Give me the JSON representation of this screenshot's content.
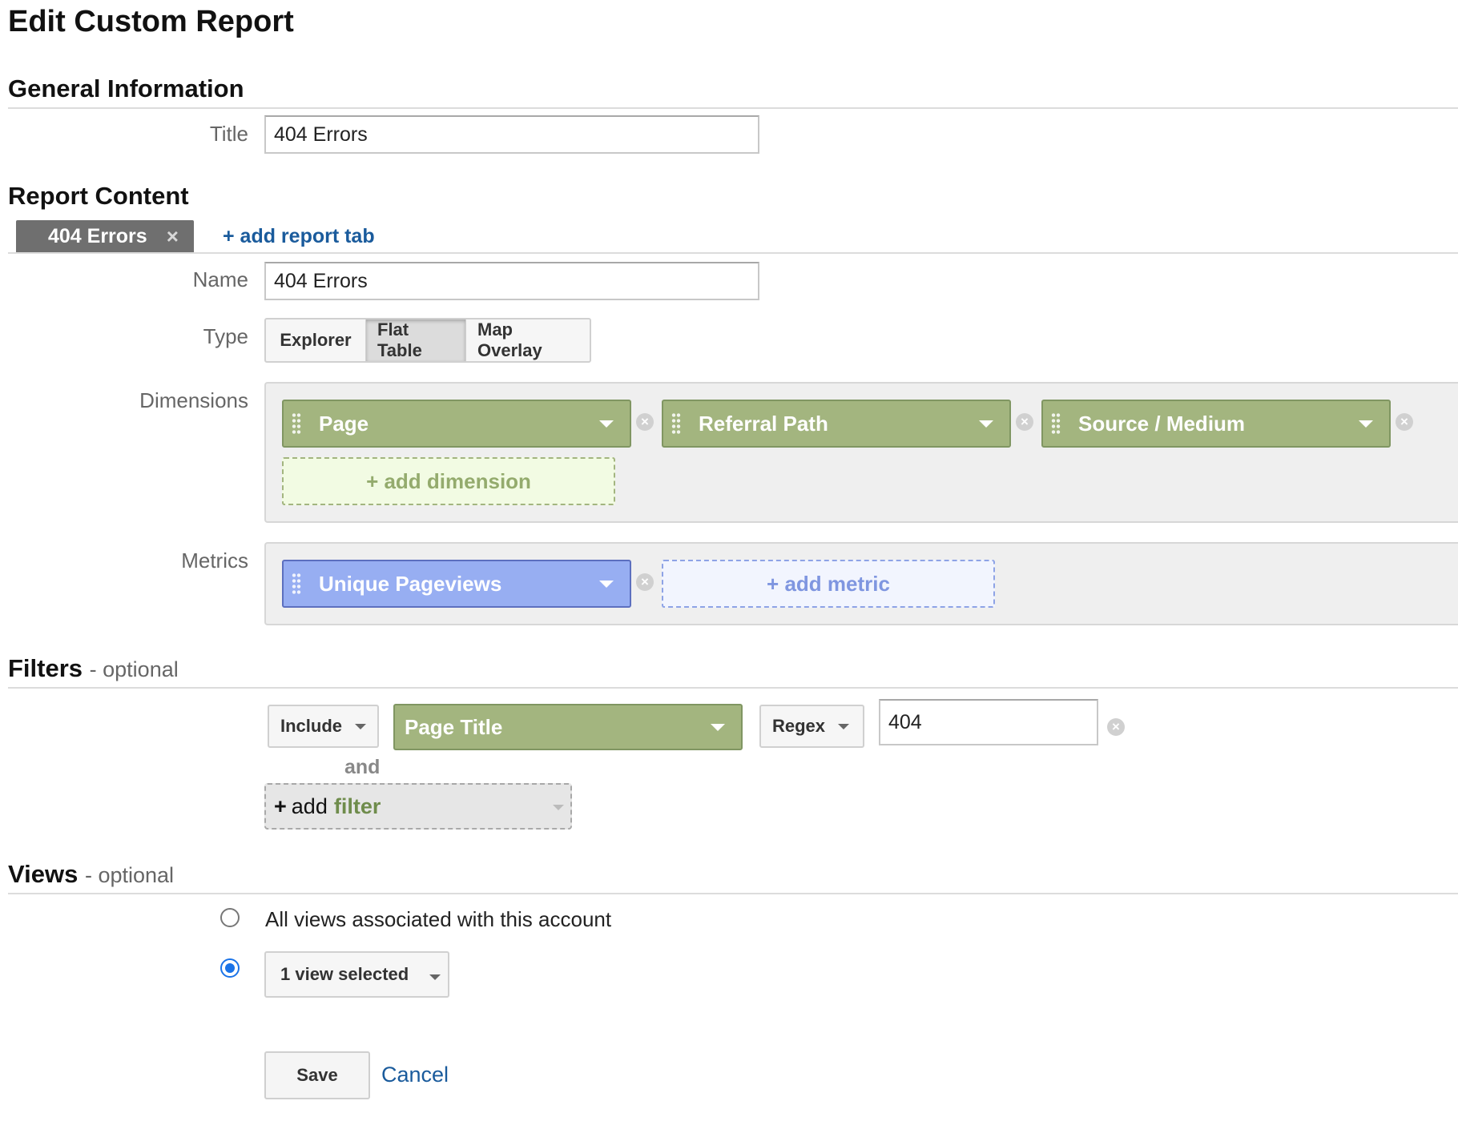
{
  "page": {
    "title": "Edit Custom Report"
  },
  "general": {
    "heading": "General Information",
    "title_label": "Title",
    "title_value": "404 Errors"
  },
  "content": {
    "heading": "Report Content",
    "tabs": [
      {
        "label": "404 Errors",
        "close": "×"
      }
    ],
    "add_tab_label": "+ add report tab",
    "name_label": "Name",
    "name_value": "404 Errors",
    "type_label": "Type",
    "types": [
      {
        "label": "Explorer",
        "selected": false
      },
      {
        "label": "Flat Table",
        "selected": true
      },
      {
        "label": "Map Overlay",
        "selected": false
      }
    ],
    "dimensions_label": "Dimensions",
    "dimensions": [
      {
        "label": "Page"
      },
      {
        "label": "Referral Path"
      },
      {
        "label": "Source / Medium"
      }
    ],
    "add_dimension_label": "+ add dimension",
    "metrics_label": "Metrics",
    "metrics": [
      {
        "label": "Unique Pageviews"
      }
    ],
    "add_metric_label": "+ add metric",
    "remove_glyph": "×"
  },
  "filters": {
    "heading": "Filters",
    "optional": "- optional",
    "rows": [
      {
        "include": "Include",
        "dimension": "Page Title",
        "match": "Regex",
        "value": "404"
      }
    ],
    "and_label": "and",
    "add_filter": {
      "plus": "+",
      "add": "add",
      "word": "filter"
    }
  },
  "views": {
    "heading": "Views",
    "optional": "- optional",
    "options": [
      {
        "label": "All views associated with this account",
        "selected": false
      },
      {
        "label": "1 view selected",
        "selected": true
      }
    ]
  },
  "actions": {
    "save": "Save",
    "cancel": "Cancel"
  },
  "colors": {
    "dimension_pill": "#a3b57f",
    "metric_pill": "#97aef2",
    "link": "#1a5b9c",
    "radio_selected": "#1a73e8"
  }
}
